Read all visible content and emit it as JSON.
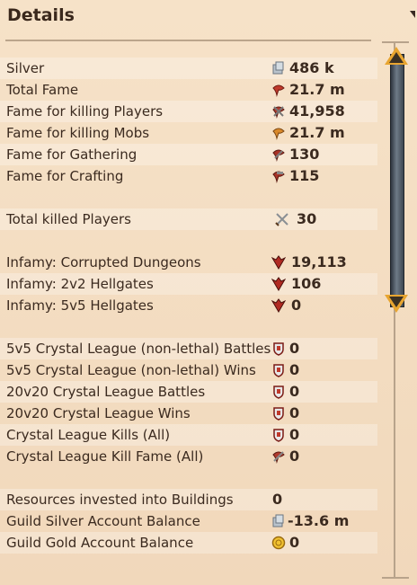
{
  "header": {
    "title": "Details"
  },
  "rows": [
    {
      "label": "Silver",
      "value": "486 k",
      "icon": "silver-icon"
    },
    {
      "label": "Total Fame",
      "value": "21.7 m",
      "icon": "fame-icon"
    },
    {
      "label": "Fame for killing Players",
      "value": "41,958",
      "icon": "pvp-fame-icon"
    },
    {
      "label": "Fame for killing Mobs",
      "value": "21.7 m",
      "icon": "pve-fame-icon"
    },
    {
      "label": "Fame for Gathering",
      "value": "130",
      "icon": "gathering-fame-icon"
    },
    {
      "label": "Fame for Crafting",
      "value": "115",
      "icon": "crafting-fame-icon"
    },
    {
      "label": "Total killed Players",
      "value": "30",
      "icon": "swords-icon"
    },
    {
      "label": "Infamy: Corrupted Dungeons",
      "value": "19,113",
      "icon": "infamy-icon"
    },
    {
      "label": "Infamy: 2v2 Hellgates",
      "value": "106",
      "icon": "infamy-icon"
    },
    {
      "label": "Infamy: 5v5 Hellgates",
      "value": "0",
      "icon": "infamy-icon"
    },
    {
      "label": "5v5 Crystal League (non-lethal) Battles",
      "value": "0",
      "icon": "crystal-shield-icon"
    },
    {
      "label": "5v5 Crystal League (non-lethal) Wins",
      "value": "0",
      "icon": "crystal-shield-icon"
    },
    {
      "label": "20v20 Crystal League Battles",
      "value": "0",
      "icon": "crystal-shield-icon"
    },
    {
      "label": "20v20 Crystal League Wins",
      "value": "0",
      "icon": "crystal-shield-icon"
    },
    {
      "label": "Crystal League Kills (All)",
      "value": "0",
      "icon": "crystal-shield-icon"
    },
    {
      "label": "Crystal League Kill Fame (All)",
      "value": "0",
      "icon": "crystal-fame-icon"
    },
    {
      "label": "Resources invested into Buildings",
      "value": "0",
      "icon": ""
    },
    {
      "label": "Guild Silver Account Balance",
      "value": "-13.6 m",
      "icon": "silver-icon"
    },
    {
      "label": "Guild Gold Account Balance",
      "value": "0",
      "icon": "gold-coin-icon"
    }
  ]
}
